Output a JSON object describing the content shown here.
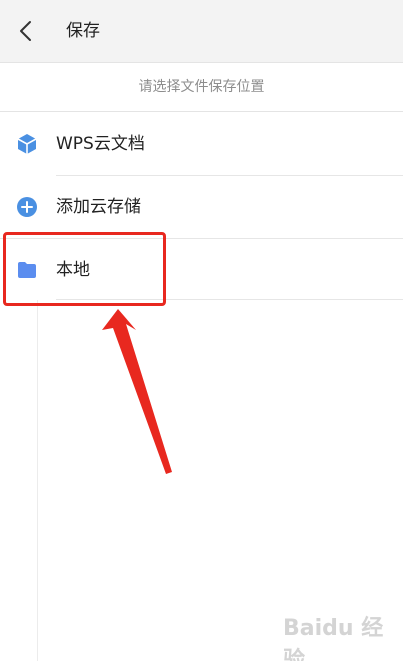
{
  "header": {
    "title": "保存"
  },
  "hint": "请选择文件保存位置",
  "items": [
    {
      "label": "WPS云文档",
      "icon": "wps-cloud-icon"
    },
    {
      "label": "添加云存储",
      "icon": "add-circle-icon"
    },
    {
      "label": "本地",
      "icon": "folder-icon"
    }
  ],
  "colors": {
    "accent": "#4a90e2",
    "highlight": "#e8281f",
    "header_bg": "#f3f3f3"
  },
  "watermark": "Baidu 经验"
}
